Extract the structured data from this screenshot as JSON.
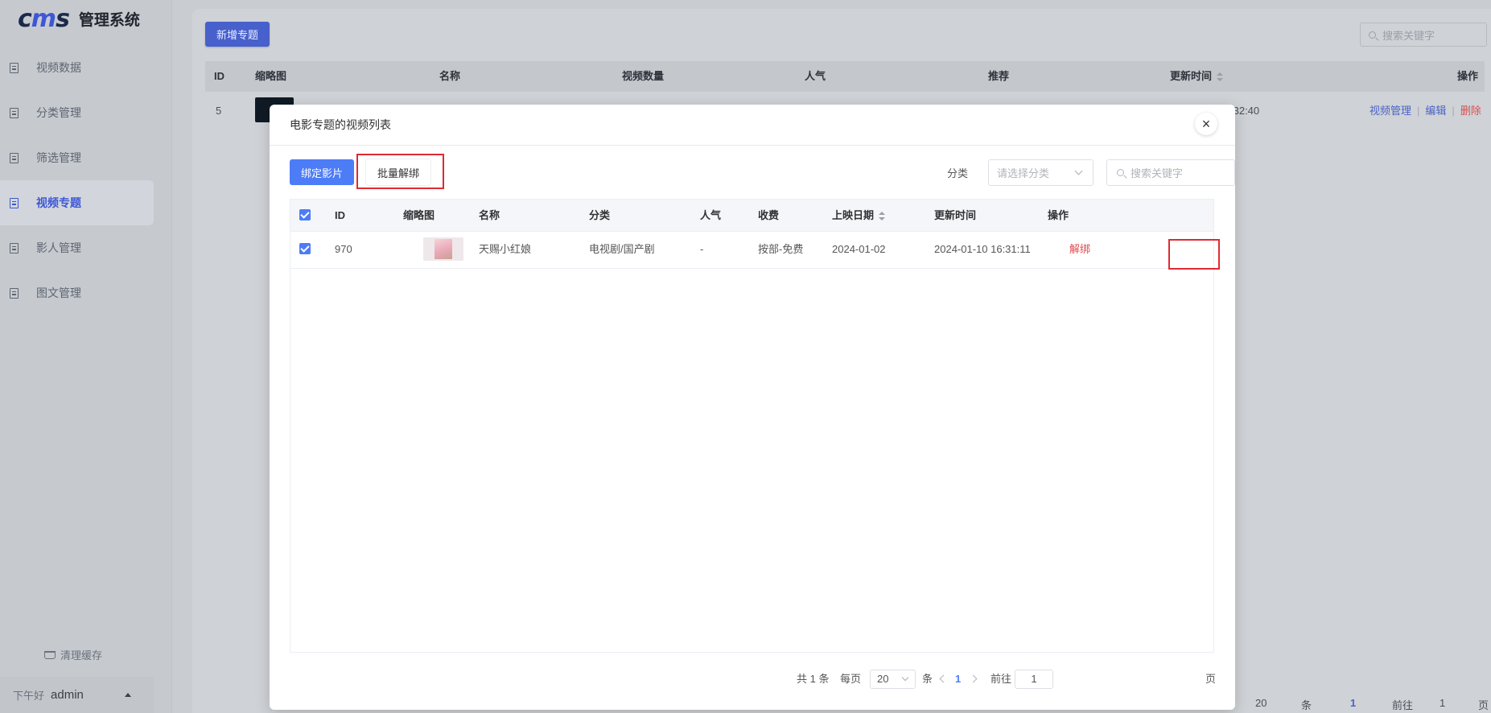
{
  "app": {
    "logo_mark": "cms",
    "logo_text": "管理系统"
  },
  "sidebar": {
    "items": [
      {
        "label": "视频数据",
        "icon": "document-icon"
      },
      {
        "label": "分类管理",
        "icon": "document-icon"
      },
      {
        "label": "筛选管理",
        "icon": "document-icon"
      },
      {
        "label": "视频专题",
        "icon": "document-icon",
        "active": true
      },
      {
        "label": "影人管理",
        "icon": "document-icon"
      },
      {
        "label": "图文管理",
        "icon": "document-icon"
      }
    ],
    "clear_cache": "清理缓存",
    "greeting": "下午好",
    "user": "admin"
  },
  "background": {
    "add_button": "新增专题",
    "search_placeholder": "搜索关键字",
    "columns": [
      "ID",
      "缩略图",
      "名称",
      "视频数量",
      "人气",
      "推荐",
      "更新时间",
      "操作"
    ],
    "row": {
      "id": "5",
      "time_tail": ":32:40",
      "actions": [
        "视频管理",
        "编辑",
        "删除"
      ]
    },
    "pager": {
      "size": "20",
      "unit": "条",
      "page": "1",
      "goto": "前往",
      "goto_value": "1",
      "page_suffix": "页"
    }
  },
  "modal": {
    "title": "电影专题的视频列表",
    "bind_button": "绑定影片",
    "batch_unbind_button": "批量解绑",
    "category_label": "分类",
    "category_placeholder": "请选择分类",
    "search_placeholder": "搜索关键字",
    "columns": [
      "ID",
      "缩略图",
      "名称",
      "分类",
      "人气",
      "收费",
      "上映日期",
      "更新时间",
      "操作"
    ],
    "rows": [
      {
        "id": "970",
        "name": "天赐小红娘",
        "category": "电视剧/国产剧",
        "popularity": "-",
        "fee": "按部-免费",
        "release_date": "2024-01-02",
        "updated": "2024-01-10 16:31:11",
        "action": "解绑"
      }
    ],
    "pager": {
      "total": "共 1 条",
      "per_page": "每页",
      "size": "20",
      "unit": "条",
      "page": "1",
      "goto": "前往",
      "goto_value": "1",
      "page_suffix": "页"
    }
  },
  "colors": {
    "primary": "#4d7cf7",
    "danger": "#e0474c",
    "highlight_box": "#e02a32"
  }
}
